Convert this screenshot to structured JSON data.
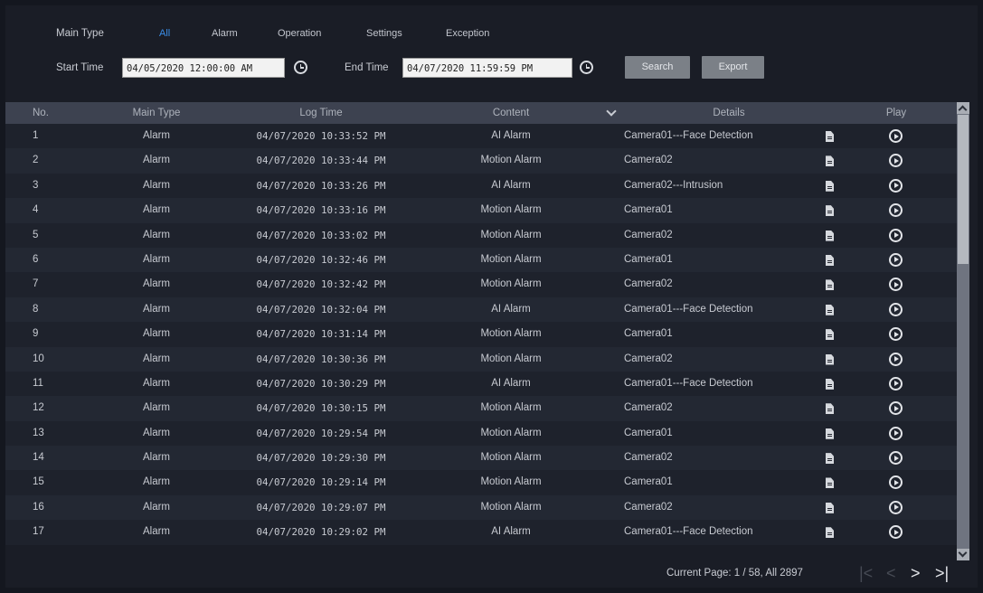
{
  "filters": {
    "main_type_label": "Main Type",
    "types": [
      "All",
      "Alarm",
      "Operation",
      "Settings",
      "Exception"
    ],
    "active_type": "All",
    "start_label": "Start Time",
    "start_value": "04/05/2020 12:00:00 AM",
    "end_label": "End Time",
    "end_value": "04/07/2020 11:59:59 PM",
    "search_label": "Search",
    "export_label": "Export"
  },
  "table": {
    "columns": [
      "No.",
      "Main Type",
      "Log Time",
      "Content",
      "Details",
      "Play"
    ],
    "rows": [
      {
        "no": "1",
        "type": "Alarm",
        "time": "04/07/2020 10:33:52 PM",
        "content": "AI Alarm",
        "details": "Camera01---Face Detection"
      },
      {
        "no": "2",
        "type": "Alarm",
        "time": "04/07/2020 10:33:44 PM",
        "content": "Motion Alarm",
        "details": "Camera02"
      },
      {
        "no": "3",
        "type": "Alarm",
        "time": "04/07/2020 10:33:26 PM",
        "content": "AI Alarm",
        "details": "Camera02---Intrusion"
      },
      {
        "no": "4",
        "type": "Alarm",
        "time": "04/07/2020 10:33:16 PM",
        "content": "Motion Alarm",
        "details": "Camera01"
      },
      {
        "no": "5",
        "type": "Alarm",
        "time": "04/07/2020 10:33:02 PM",
        "content": "Motion Alarm",
        "details": "Camera02"
      },
      {
        "no": "6",
        "type": "Alarm",
        "time": "04/07/2020 10:32:46 PM",
        "content": "Motion Alarm",
        "details": "Camera01"
      },
      {
        "no": "7",
        "type": "Alarm",
        "time": "04/07/2020 10:32:42 PM",
        "content": "Motion Alarm",
        "details": "Camera02"
      },
      {
        "no": "8",
        "type": "Alarm",
        "time": "04/07/2020 10:32:04 PM",
        "content": "AI Alarm",
        "details": "Camera01---Face Detection"
      },
      {
        "no": "9",
        "type": "Alarm",
        "time": "04/07/2020 10:31:14 PM",
        "content": "Motion Alarm",
        "details": "Camera01"
      },
      {
        "no": "10",
        "type": "Alarm",
        "time": "04/07/2020 10:30:36 PM",
        "content": "Motion Alarm",
        "details": "Camera02"
      },
      {
        "no": "11",
        "type": "Alarm",
        "time": "04/07/2020 10:30:29 PM",
        "content": "AI Alarm",
        "details": "Camera01---Face Detection"
      },
      {
        "no": "12",
        "type": "Alarm",
        "time": "04/07/2020 10:30:15 PM",
        "content": "Motion Alarm",
        "details": "Camera02"
      },
      {
        "no": "13",
        "type": "Alarm",
        "time": "04/07/2020 10:29:54 PM",
        "content": "Motion Alarm",
        "details": "Camera01"
      },
      {
        "no": "14",
        "type": "Alarm",
        "time": "04/07/2020 10:29:30 PM",
        "content": "Motion Alarm",
        "details": "Camera02"
      },
      {
        "no": "15",
        "type": "Alarm",
        "time": "04/07/2020 10:29:14 PM",
        "content": "Motion Alarm",
        "details": "Camera01"
      },
      {
        "no": "16",
        "type": "Alarm",
        "time": "04/07/2020 10:29:07 PM",
        "content": "Motion Alarm",
        "details": "Camera02"
      },
      {
        "no": "17",
        "type": "Alarm",
        "time": "04/07/2020 10:29:02 PM",
        "content": "AI Alarm",
        "details": "Camera01---Face Detection"
      }
    ]
  },
  "pagination": {
    "info": "Current Page: 1 / 58, All 2897",
    "first_glyph": "|<",
    "prev_glyph": "<",
    "next_glyph": ">",
    "last_glyph": ">|"
  },
  "colors": {
    "background": "#1a1d26",
    "header": "#3d4250",
    "accent": "#3b8ee8",
    "button": "#7b8087"
  },
  "icons": {
    "clock": "clock-icon",
    "details": "document-icon",
    "play": "play-circle-icon",
    "sort": "chevron-down-icon"
  }
}
